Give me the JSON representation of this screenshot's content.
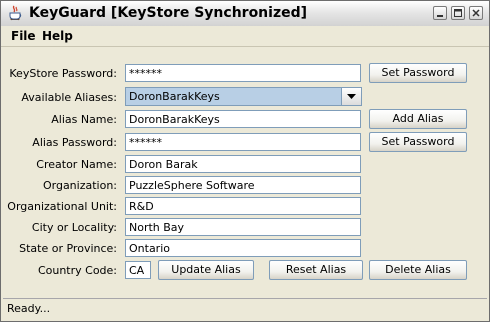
{
  "window": {
    "title": "KeyGuard [KeyStore Synchronized]",
    "icon": "java-coffee-icon"
  },
  "menu": {
    "file": "File",
    "help": "Help"
  },
  "form": {
    "keystore_password": {
      "label": "KeyStore Password:",
      "value": "******"
    },
    "available_aliases": {
      "label": "Available Aliases:",
      "value": "DoronBarakKeys"
    },
    "alias_name": {
      "label": "Alias Name:",
      "value": "DoronBarakKeys"
    },
    "alias_password": {
      "label": "Alias Password:",
      "value": "******"
    },
    "creator_name": {
      "label": "Creator Name:",
      "value": "Doron Barak"
    },
    "organization": {
      "label": "Organization:",
      "value": "PuzzleSphere Software"
    },
    "organizational_unit": {
      "label": "Organizational Unit:",
      "value": "R&D"
    },
    "city": {
      "label": "City or Locality:",
      "value": "North Bay"
    },
    "state": {
      "label": "State or Province:",
      "value": "Ontario"
    },
    "country": {
      "label": "Country Code:",
      "value": "CA"
    }
  },
  "buttons": {
    "set_password_keystore": "Set Password",
    "add_alias": "Add Alias",
    "set_password_alias": "Set Password",
    "update_alias": "Update Alias",
    "reset_alias": "Reset Alias",
    "delete_alias": "Delete Alias"
  },
  "status": "Ready...",
  "colors": {
    "combo_selection": "#B8CFE5",
    "field_border": "#7F9DB9",
    "window_bg": "#ECE9D8"
  }
}
